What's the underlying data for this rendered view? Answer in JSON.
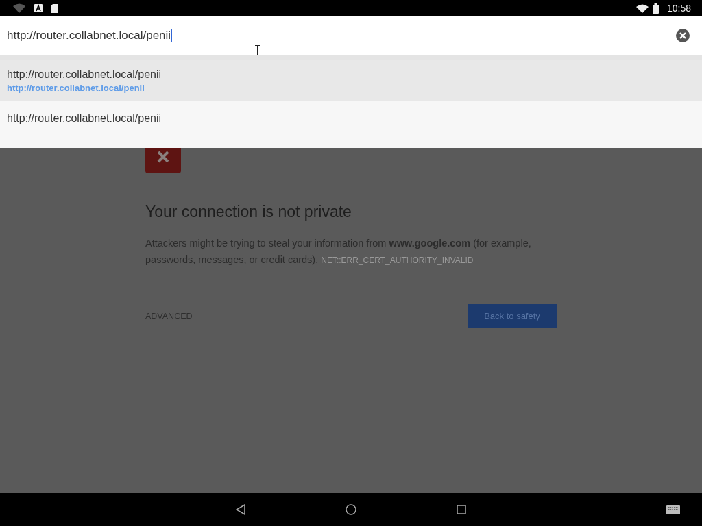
{
  "status_bar": {
    "time": "10:58"
  },
  "omnibox": {
    "value": "http://router.collabnet.local/penii"
  },
  "suggestions": [
    {
      "title": "http://router.collabnet.local/penii",
      "url": "http://router.collabnet.local/penii",
      "selected": true
    },
    {
      "title": "http://router.collabnet.local/penii",
      "selected": false
    }
  ],
  "interstitial": {
    "heading": "Your connection is not private",
    "message": "Attackers might be trying to steal your information from **www.google.com** (for example, passwords, messages, or credit cards).",
    "error_code": "NET::ERR_CERT_AUTHORITY_INVALID",
    "advanced": "ADVANCED",
    "primary_button": "Back to safety"
  }
}
